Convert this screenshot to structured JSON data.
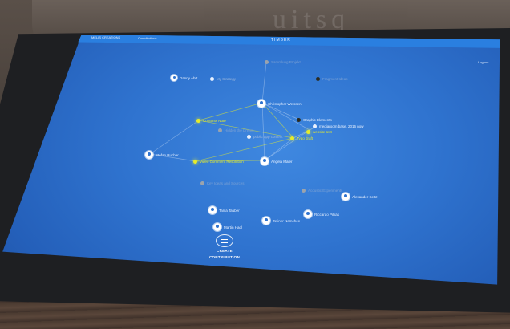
{
  "background": {
    "mark_text": "uitsq"
  },
  "topbar": {
    "left_label": "MELIS CREATIONS",
    "second_label": "Contributions",
    "center_label": "TIMBER",
    "right_label": "Log out"
  },
  "nodes": {
    "top_dot": "Sammlung Projekt",
    "danny": "Danny Ahrt",
    "sketch": "My Strategy",
    "dark_right": "Fragment Ideas",
    "christopher": "Christopher Weissen",
    "contents": "Contents Note",
    "hidden_dream": "Hidden the Dream",
    "dark_mid": "Graphic Elements",
    "media": "mediaroom base, 2016 now",
    "website": "website text",
    "public": "public app content",
    "typo": "Typo draft",
    "stefan": "Stefan Rucher",
    "video": "Video Comment Resolution",
    "angela": "Angela Maier",
    "key_ideas": "Key Ideas and Sources",
    "acoustic": "Acoustic Experiments",
    "alexander": "Alexander Seitz",
    "tanja": "Tanja Tauber",
    "riccardo": "Riccardo Pilkas",
    "zeliner": "Zeliner Nemchec",
    "martin": "Martin Hagl"
  },
  "create": {
    "line1": "CREATE",
    "line2": "CONTRIBUTION"
  },
  "colors": {
    "screen": "#2f73cf",
    "accent": "#e6ec2a",
    "topbar": "#2a7fe0"
  }
}
